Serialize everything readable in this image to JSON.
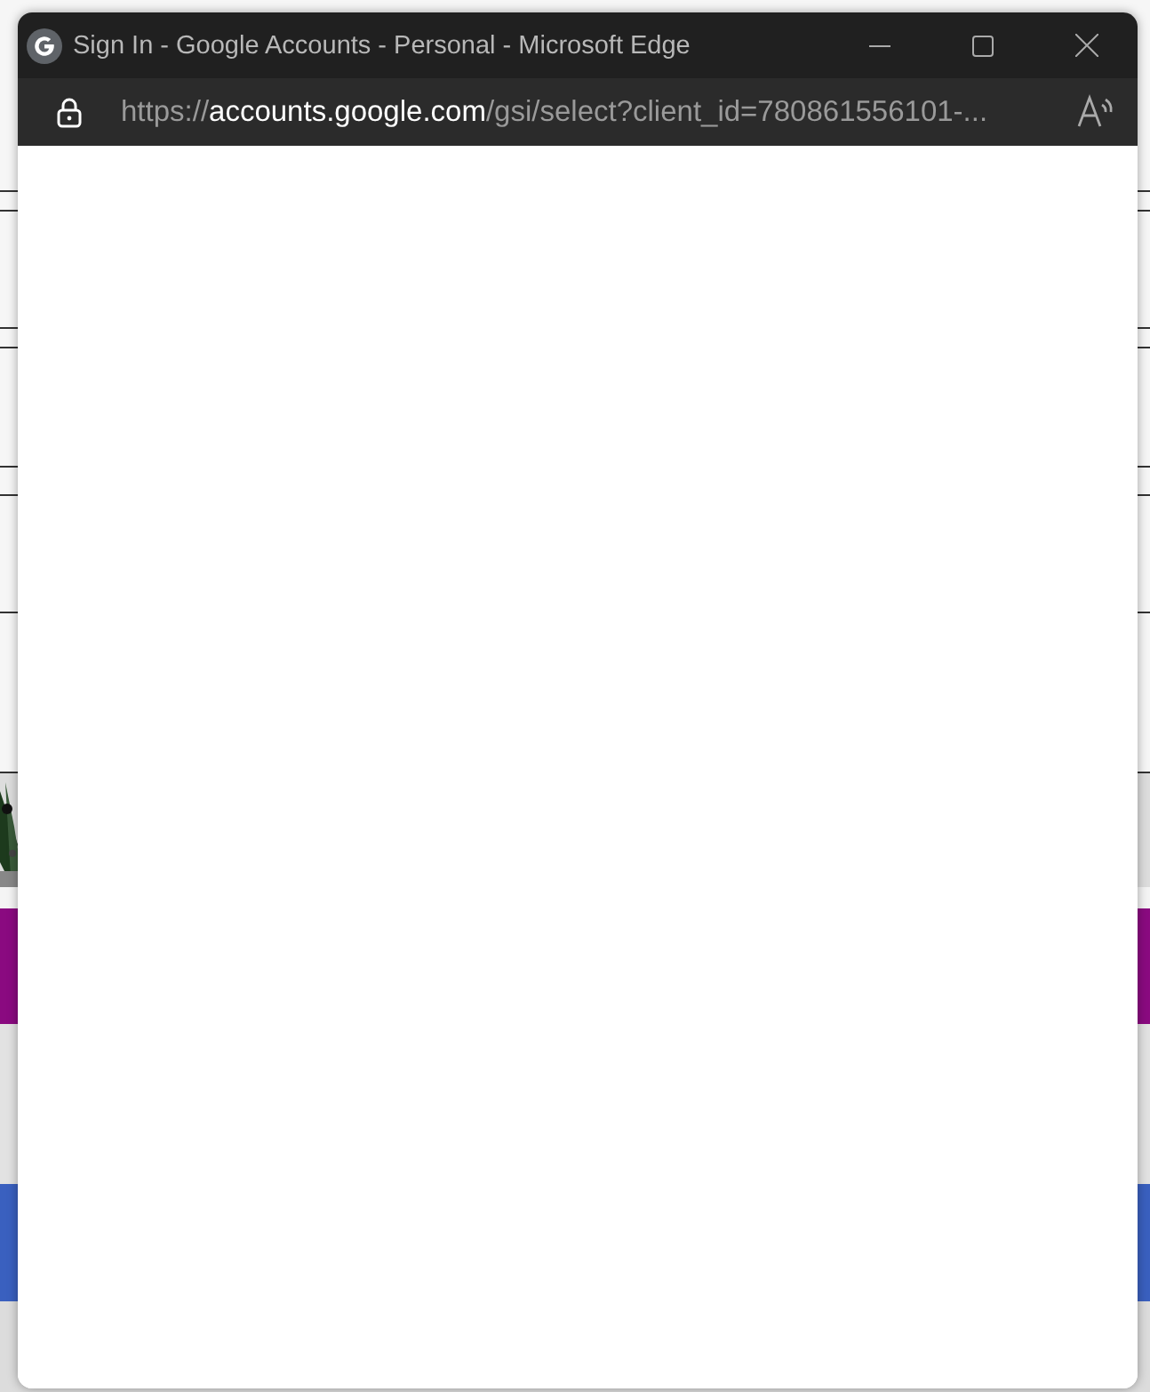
{
  "window": {
    "title": "Sign In - Google Accounts - Personal - Microsoft Edge",
    "url": {
      "scheme": "https://",
      "host": "accounts.google.com",
      "path": "/gsi/select?client_id=780861556101-..."
    }
  }
}
